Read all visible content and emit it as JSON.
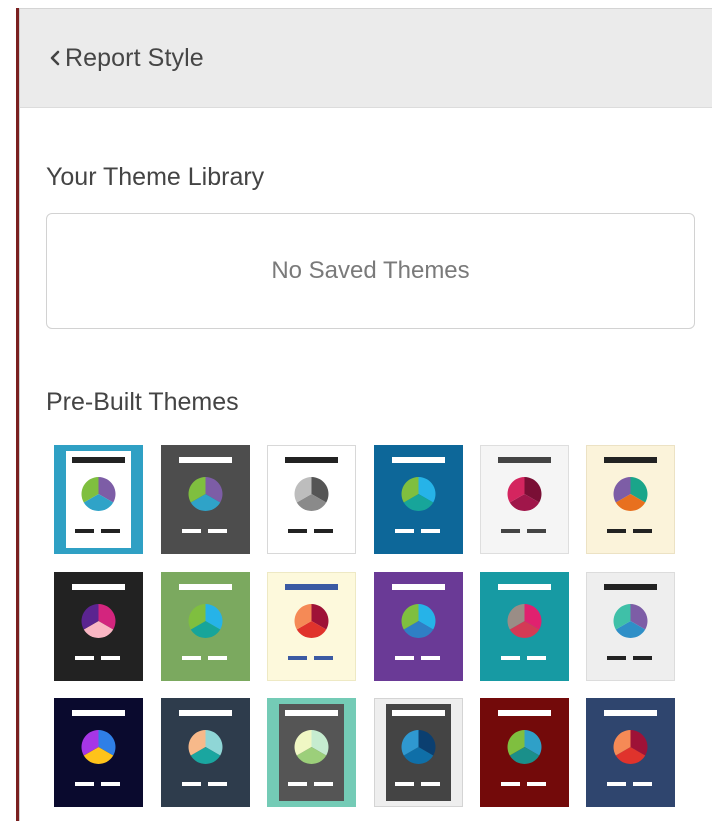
{
  "header": {
    "back_label": "Report Style"
  },
  "library": {
    "title": "Your Theme Library",
    "empty_text": "No Saved Themes"
  },
  "prebuilt": {
    "title": "Pre-Built Themes",
    "themes": [
      {
        "name": "theme-1",
        "bg": "#2fa0c4",
        "card": "#ffffff",
        "bar": "#222222",
        "dash": "#222222",
        "pie": [
          "#7d5da6",
          "#2fa3c8",
          "#7fbf3f"
        ],
        "frame": true
      },
      {
        "name": "theme-2",
        "bg": "#4d4d4d",
        "card": null,
        "bar": "#ffffff",
        "dash": "#ffffff",
        "pie": [
          "#7d5da6",
          "#2fa3c8",
          "#7fbf3f"
        ]
      },
      {
        "name": "theme-3",
        "bg": "#ffffff",
        "card": null,
        "bar": "#222222",
        "dash": "#222222",
        "pie": [
          "#555555",
          "#8a8a8a",
          "#bdbdbd"
        ],
        "border": "#d8d8d8"
      },
      {
        "name": "theme-4",
        "bg": "#0d6799",
        "card": null,
        "bar": "#ffffff",
        "dash": "#ffffff",
        "pie": [
          "#26b3e8",
          "#17a59a",
          "#7fbf3f"
        ]
      },
      {
        "name": "theme-5",
        "bg": "#f5f5f5",
        "card": null,
        "bar": "#444444",
        "dash": "#444444",
        "pie": [
          "#7a0f35",
          "#a0164a",
          "#d4255f"
        ],
        "border": "#dedede"
      },
      {
        "name": "theme-6",
        "bg": "#fbf3da",
        "card": null,
        "bar": "#222222",
        "dash": "#222222",
        "pie": [
          "#1aa58a",
          "#e8701e",
          "#7d5da6"
        ],
        "border": "#ece2c4"
      },
      {
        "name": "theme-7",
        "bg": "#222222",
        "card": null,
        "bar": "#ffffff",
        "dash": "#ffffff",
        "pie": [
          "#d3257e",
          "#f9b6c3",
          "#5b2490"
        ]
      },
      {
        "name": "theme-8",
        "bg": "#7ba95f",
        "card": null,
        "bar": "#ffffff",
        "dash": "#ffffff",
        "pie": [
          "#26b3e8",
          "#17a59a",
          "#7fbf3f"
        ]
      },
      {
        "name": "theme-9",
        "bg": "#fdf9dc",
        "card": null,
        "bar": "#3b5aa3",
        "dash": "#3b5aa3",
        "pie": [
          "#9e1237",
          "#e0332c",
          "#f58a56"
        ],
        "border": "#eee9c4"
      },
      {
        "name": "theme-10",
        "bg": "#6a3a96",
        "card": null,
        "bar": "#ffffff",
        "dash": "#ffffff",
        "pie": [
          "#26b3e8",
          "#2f7fc5",
          "#7fbf3f"
        ]
      },
      {
        "name": "theme-11",
        "bg": "#179aa3",
        "card": null,
        "bar": "#ffffff",
        "dash": "#ffffff",
        "pie": [
          "#e0216f",
          "#d43a55",
          "#9a8d86"
        ]
      },
      {
        "name": "theme-12",
        "bg": "#eeeeee",
        "card": null,
        "bar": "#222222",
        "dash": "#222222",
        "pie": [
          "#7d5da6",
          "#2f8fc7",
          "#3fc0a8"
        ],
        "border": "#dcdcdc"
      },
      {
        "name": "theme-13",
        "bg": "#0a0a2e",
        "card": null,
        "bar": "#ffffff",
        "dash": "#ffffff",
        "pie": [
          "#2f7fe6",
          "#ffc31a",
          "#a636e6"
        ]
      },
      {
        "name": "theme-14",
        "bg": "#2e3c4c",
        "card": null,
        "bar": "#ffffff",
        "dash": "#ffffff",
        "pie": [
          "#8fd6d6",
          "#1aa6a0",
          "#f7b98a"
        ]
      },
      {
        "name": "theme-15",
        "bg": "#74cbb6",
        "card": "#555555",
        "bar": "#ffffff",
        "dash": "#ffffff",
        "pie": [
          "#c6ecd0",
          "#9ccf7a",
          "#f0f7c4"
        ],
        "frame": true
      },
      {
        "name": "theme-16",
        "bg": "#eeeeee",
        "card": "#444444",
        "bar": "#ffffff",
        "dash": "#ffffff",
        "pie": [
          "#0b3f70",
          "#0f6fa8",
          "#2f98d0"
        ],
        "frame": true,
        "border": "#d4d4d4"
      },
      {
        "name": "theme-17",
        "bg": "#730a0a",
        "card": null,
        "bar": "#ffffff",
        "dash": "#ffffff",
        "pie": [
          "#2fa0c8",
          "#1a8f8a",
          "#7fbf3f"
        ]
      },
      {
        "name": "theme-18",
        "bg": "#2f456e",
        "card": null,
        "bar": "#ffffff",
        "dash": "#ffffff",
        "pie": [
          "#9e1237",
          "#e0332c",
          "#f58a56"
        ]
      }
    ]
  }
}
